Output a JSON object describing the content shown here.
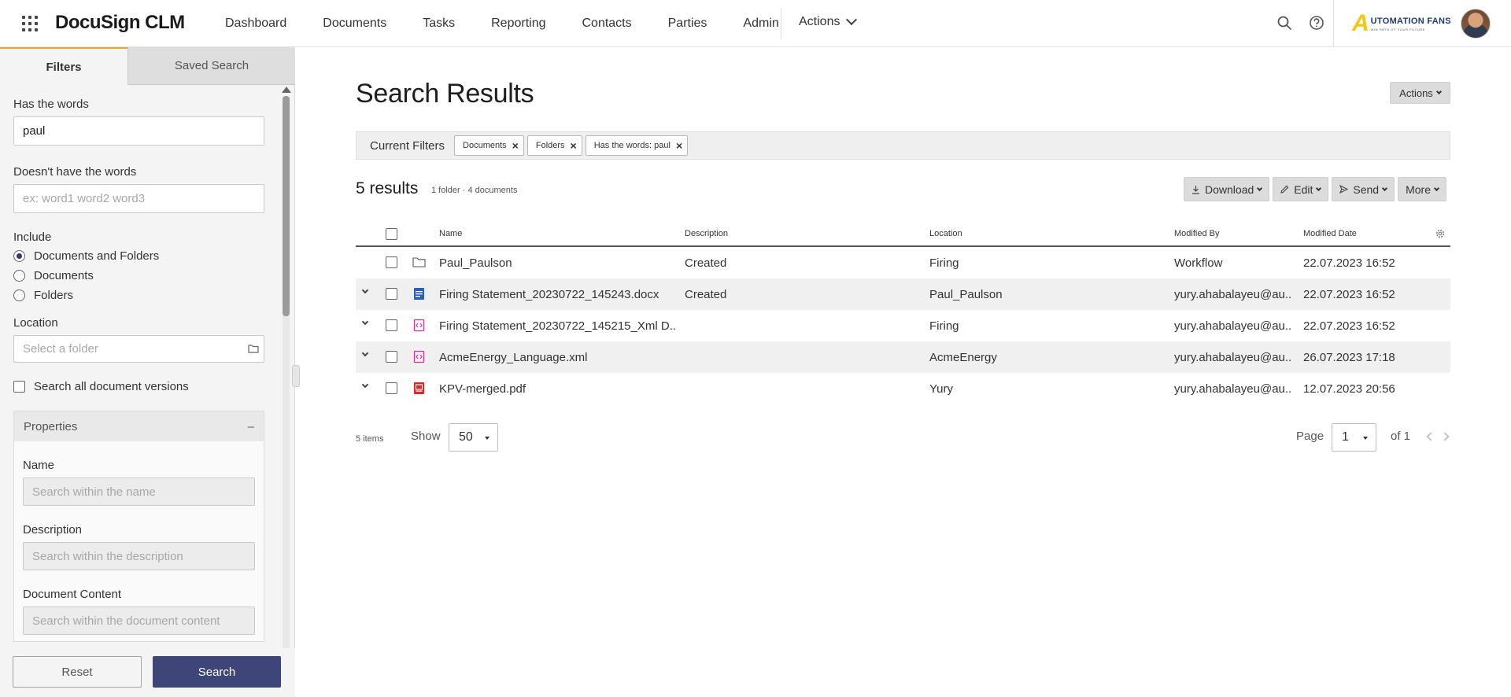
{
  "app": {
    "brand": "DocuSign CLM"
  },
  "nav": {
    "items": [
      "Dashboard",
      "Documents",
      "Tasks",
      "Reporting",
      "Contacts",
      "Parties",
      "Admin"
    ],
    "actions_label": "Actions"
  },
  "logo": {
    "main": "UTOMATION FANS",
    "letter": "A",
    "sub": "WIN PATH OF YOUR FUTURE"
  },
  "sidebar": {
    "tabs": {
      "filters": "Filters",
      "saved": "Saved Search"
    },
    "has_words_label": "Has the words",
    "has_words_value": "paul",
    "not_words_label": "Doesn't have the words",
    "not_words_placeholder": "ex: word1 word2 word3",
    "include_label": "Include",
    "include_options": [
      "Documents and Folders",
      "Documents",
      "Folders"
    ],
    "include_selected": 0,
    "location_label": "Location",
    "location_placeholder": "Select a folder",
    "versions_label": "Search all document versions",
    "properties": {
      "title": "Properties",
      "toggle": "–",
      "name_label": "Name",
      "name_placeholder": "Search within the name",
      "desc_label": "Description",
      "desc_placeholder": "Search within the description",
      "content_label": "Document Content",
      "content_placeholder": "Search within the document content"
    },
    "reset_label": "Reset",
    "search_label": "Search"
  },
  "main": {
    "title": "Search Results",
    "actions_label": "Actions",
    "current_filters_label": "Current Filters",
    "filter_chips": [
      "Documents",
      "Folders",
      "Has the words: paul"
    ],
    "results_count": "5 results",
    "results_sub": "1 folder · 4 documents",
    "toolbar": {
      "download": "Download",
      "edit": "Edit",
      "send": "Send",
      "more": "More"
    },
    "columns": [
      "Name",
      "Description",
      "Location",
      "Modified By",
      "Modified Date"
    ],
    "rows": [
      {
        "type": "folder",
        "expandable": false,
        "name": "Paul_Paulson",
        "description": "Created",
        "location": "Firing",
        "modified_by": "Workflow",
        "modified_date": "22.07.2023 16:52"
      },
      {
        "type": "docx",
        "expandable": true,
        "name": "Firing Statement_20230722_145243.docx",
        "description": "Created",
        "location": "Paul_Paulson",
        "modified_by": "yury.ahabalayeu@au...",
        "modified_date": "22.07.2023 16:52"
      },
      {
        "type": "xml",
        "expandable": true,
        "name": "Firing Statement_20230722_145215_Xml D...",
        "description": "",
        "location": "Firing",
        "modified_by": "yury.ahabalayeu@au...",
        "modified_date": "22.07.2023 16:52"
      },
      {
        "type": "xml",
        "expandable": true,
        "name": "AcmeEnergy_Language.xml",
        "description": "",
        "location": "AcmeEnergy",
        "modified_by": "yury.ahabalayeu@au...",
        "modified_date": "26.07.2023 17:18"
      },
      {
        "type": "pdf",
        "expandable": true,
        "name": "KPV-merged.pdf",
        "description": "",
        "location": "Yury",
        "modified_by": "yury.ahabalayeu@au...",
        "modified_date": "12.07.2023 20:56"
      }
    ],
    "pager": {
      "items": "5 items",
      "show_label": "Show",
      "page_size": "50",
      "page_label": "Page",
      "page": "1",
      "of": "of 1"
    }
  },
  "colors": {
    "accent": "#3d4676",
    "tab_indicator": "#e8a33d",
    "docx": "#2b5eb5",
    "xml": "#d6338a",
    "pdf": "#d62828"
  }
}
